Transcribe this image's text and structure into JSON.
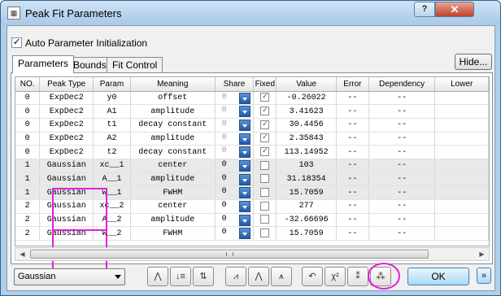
{
  "window": {
    "title": "Peak Fit Parameters",
    "help_label": "?",
    "close_label": "✕"
  },
  "auto_init": {
    "label": "Auto Parameter Initialization",
    "checked": true
  },
  "tabs": [
    {
      "label": "Parameters",
      "active": true
    },
    {
      "label": "Bounds",
      "active": false
    },
    {
      "label": "Fit Control",
      "active": false
    }
  ],
  "hide_button": "Hide...",
  "table": {
    "columns": [
      "NO.",
      "Peak Type",
      "Param",
      "Meaning",
      "Share",
      "Fixed",
      "Value",
      "Error",
      "Dependency",
      "Lower"
    ],
    "rows": [
      {
        "no": "0",
        "peak_type": "ExpDec2",
        "param": "y0",
        "meaning": "offset",
        "share": "0",
        "share_dim": true,
        "fixed": true,
        "value": "-0.26022",
        "error": "--",
        "dependency": "--",
        "lower": ""
      },
      {
        "no": "0",
        "peak_type": "ExpDec2",
        "param": "A1",
        "meaning": "amplitude",
        "share": "0",
        "share_dim": true,
        "fixed": true,
        "value": "3.41623",
        "error": "--",
        "dependency": "--",
        "lower": ""
      },
      {
        "no": "0",
        "peak_type": "ExpDec2",
        "param": "t1",
        "meaning": "decay constant",
        "share": "0",
        "share_dim": true,
        "fixed": true,
        "value": "30.4456",
        "error": "--",
        "dependency": "--",
        "lower": ""
      },
      {
        "no": "0",
        "peak_type": "ExpDec2",
        "param": "A2",
        "meaning": "amplitude",
        "share": "0",
        "share_dim": true,
        "fixed": true,
        "value": "2.35843",
        "error": "--",
        "dependency": "--",
        "lower": ""
      },
      {
        "no": "0",
        "peak_type": "ExpDec2",
        "param": "t2",
        "meaning": "decay constant",
        "share": "0",
        "share_dim": true,
        "fixed": true,
        "value": "113.14952",
        "error": "--",
        "dependency": "--",
        "lower": ""
      },
      {
        "no": "1",
        "peak_type": "Gaussian",
        "param": "xc__1",
        "meaning": "center",
        "share": "0",
        "share_dim": false,
        "fixed": false,
        "value": "103",
        "error": "--",
        "dependency": "--",
        "lower": ""
      },
      {
        "no": "1",
        "peak_type": "Gaussian",
        "param": "A__1",
        "meaning": "amplitude",
        "share": "0",
        "share_dim": false,
        "fixed": false,
        "value": "31.18354",
        "error": "--",
        "dependency": "--",
        "lower": ""
      },
      {
        "no": "1",
        "peak_type": "Gaussian",
        "param": "w__1",
        "meaning": "FWHM",
        "share": "0",
        "share_dim": false,
        "fixed": false,
        "value": "15.7059",
        "error": "--",
        "dependency": "--",
        "lower": ""
      },
      {
        "no": "2",
        "peak_type": "Gaussian",
        "param": "xc__2",
        "meaning": "center",
        "share": "0",
        "share_dim": false,
        "fixed": false,
        "value": "277",
        "error": "--",
        "dependency": "--",
        "lower": ""
      },
      {
        "no": "2",
        "peak_type": "Gaussian",
        "param": "A__2",
        "meaning": "amplitude",
        "share": "0",
        "share_dim": false,
        "fixed": false,
        "value": "-32.66696",
        "error": "--",
        "dependency": "--",
        "lower": ""
      },
      {
        "no": "2",
        "peak_type": "Gaussian",
        "param": "w__2",
        "meaning": "FWHM",
        "share": "0",
        "share_dim": false,
        "fixed": false,
        "value": "15.7059",
        "error": "--",
        "dependency": "--",
        "lower": ""
      }
    ]
  },
  "function_combo": {
    "value": "Gaussian"
  },
  "toolbar": [
    {
      "name": "fit-peak-shape-button",
      "glyph": "⋀"
    },
    {
      "name": "sort-params-button",
      "glyph": "↓≡"
    },
    {
      "name": "reorder-params-button",
      "glyph": "⇅"
    },
    {
      "name": "add-peak-button",
      "glyph": "⩘"
    },
    {
      "name": "peak-shape-button",
      "glyph": "⋀"
    },
    {
      "name": "peak-area-button",
      "glyph": "⩚"
    },
    {
      "name": "reset-button",
      "glyph": "↶"
    },
    {
      "name": "chi-square-button",
      "glyph": "χ²"
    },
    {
      "name": "one-iteration-button",
      "glyph": "⁑"
    },
    {
      "name": "fit-until-converged-button",
      "glyph": "⁂"
    }
  ],
  "ok_label": "OK",
  "more_label": "»"
}
